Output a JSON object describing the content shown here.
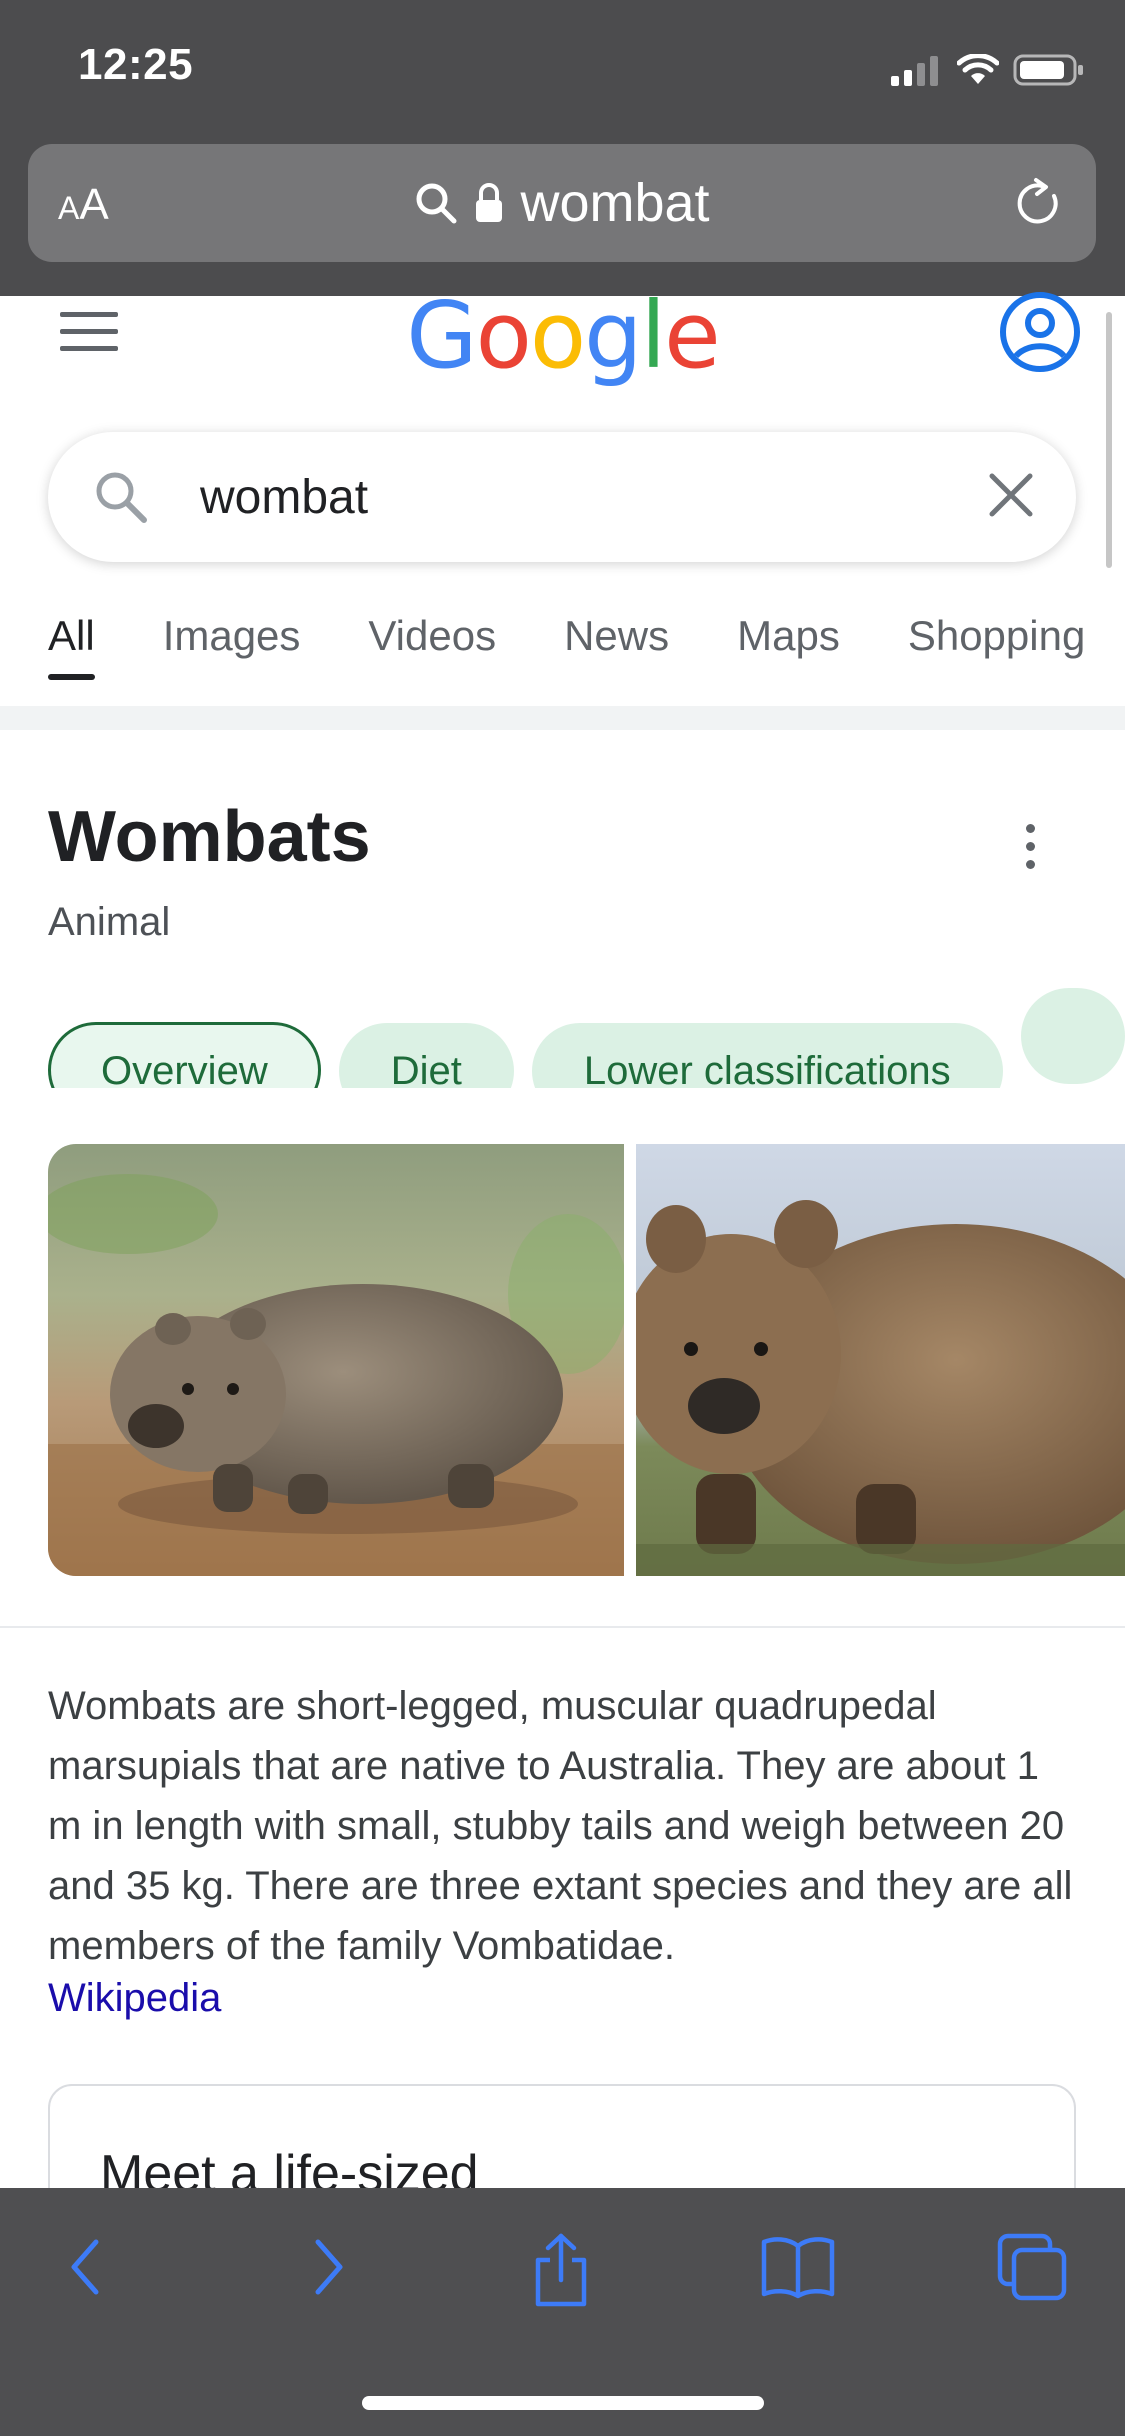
{
  "status_bar": {
    "time": "12:25"
  },
  "browser": {
    "text_size_label_small": "A",
    "text_size_label_large": "A",
    "address_text": "wombat"
  },
  "google": {
    "logo_text": "Google",
    "logo_colors": [
      "#4285F4",
      "#EA4335",
      "#FBBC05",
      "#4285F4",
      "#34A853",
      "#EA4335"
    ],
    "search_query": "wombat",
    "tabs": [
      {
        "label": "All",
        "active": true
      },
      {
        "label": "Images"
      },
      {
        "label": "Videos"
      },
      {
        "label": "News"
      },
      {
        "label": "Maps"
      },
      {
        "label": "Shopping"
      }
    ]
  },
  "knowledge_panel": {
    "title": "Wombats",
    "subtitle": "Animal",
    "chips": [
      {
        "label": "Overview",
        "active": true
      },
      {
        "label": "Diet"
      },
      {
        "label": "Lower classifications"
      },
      {
        "label": ""
      }
    ],
    "description": "Wombats are short-legged, muscular quadrupedal marsupials that are native to Australia. They are about 1 m in length with small, stubby tails and weigh between 20 and 35 kg. There are three extant species and they are all members of the family Vombatidae.",
    "source_link": "Wikipedia",
    "card_text": "Meet a life-sized"
  },
  "toolbar": {
    "icons": [
      "back-icon",
      "forward-icon",
      "share-icon",
      "bookmarks-icon",
      "tabs-icon"
    ]
  },
  "colors": {
    "chrome_bg": "#4c4c4e",
    "address_bg": "#767678",
    "toolbar_icon": "#3d7bf7",
    "chip_bg": "#dbf1e4",
    "chip_text": "#1e6b3a",
    "link": "#1a0dab"
  }
}
